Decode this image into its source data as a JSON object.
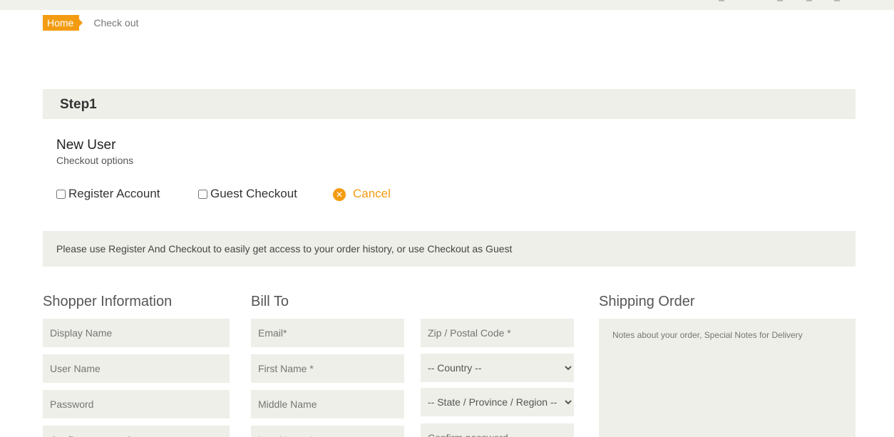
{
  "breadcrumb": {
    "home": "Home",
    "current": "Check out"
  },
  "step": {
    "title": "Step1"
  },
  "new_user": {
    "title": "New User",
    "subtitle": "Checkout options"
  },
  "options": {
    "register": "Register Account",
    "guest": "Guest Checkout",
    "cancel": "Cancel",
    "cancel_icon": "close-circle-icon"
  },
  "notice": "Please use Register And Checkout to easily get access to your order history, or use Checkout as Guest",
  "shopper": {
    "title": "Shopper Information",
    "display_name": "Display Name",
    "user_name": "User Name",
    "password": "Password",
    "confirm_password": "Confirm password"
  },
  "bill_to": {
    "title": "Bill To",
    "email": "Email*",
    "first_name": "First Name *",
    "middle_name": "Middle Name",
    "last_name": "Last Name *",
    "zip": "Zip / Postal Code *",
    "country": "-- Country --",
    "state": "-- State / Province / Region --",
    "confirm_password": "Confirm password"
  },
  "shipping": {
    "title": "Shipping Order",
    "notes_placeholder": "Notes about your order, Special Notes for Delivery"
  },
  "colors": {
    "accent": "#f39c12",
    "panel": "#efefe9"
  }
}
